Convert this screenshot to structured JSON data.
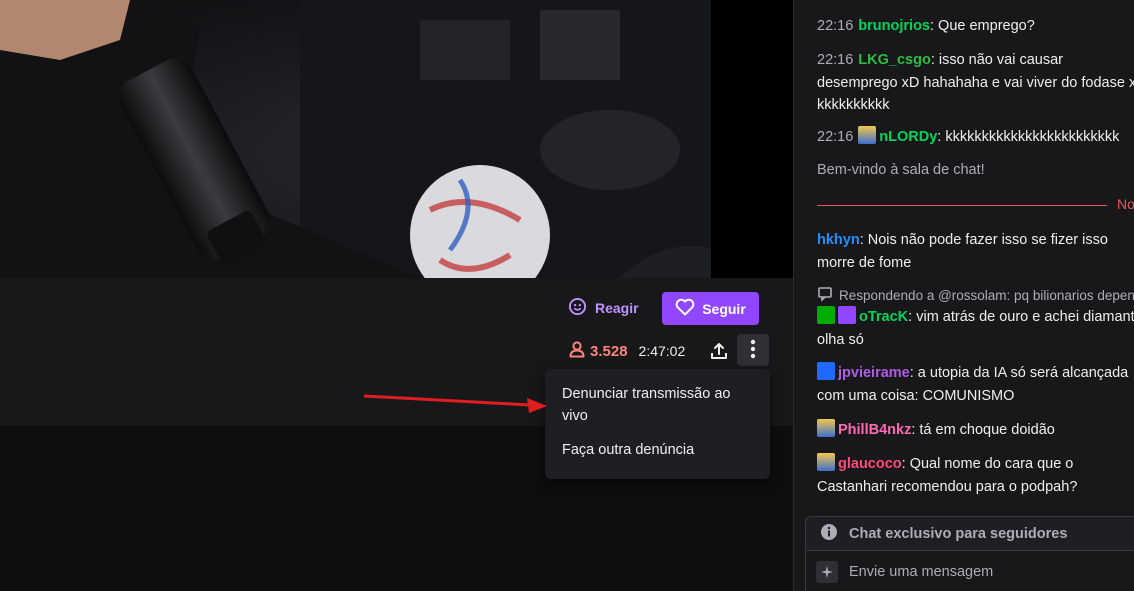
{
  "player": {
    "react_label": "Reagir",
    "follow_label": "Seguir",
    "viewer_count": "3.528",
    "uptime": "2:47:02"
  },
  "more_menu": {
    "items": [
      {
        "label": "Denunciar transmissão ao vivo"
      },
      {
        "label": "Faça outra denúncia"
      }
    ]
  },
  "chat": {
    "messages": [
      {
        "time": "22:16",
        "user": "brunojrios",
        "text": ": Que emprego?",
        "color": "#00d45b"
      },
      {
        "time": "22:16",
        "user": "LKG_csgo",
        "text": ": isso não vai causar desemprego xD hahahaha e vai viver do fodase xD kkkkkkkkkk",
        "color": "#2ebd40"
      },
      {
        "time": "22:16",
        "user": "nLORDy",
        "text": ": kkkkkkkkkkkkkkkkkkkkkkkk",
        "color": "#00d45b"
      }
    ],
    "welcome": "Bem-vindo à sala de chat!",
    "new_label": "Novas",
    "new_messages": [
      {
        "user": "hkhyn",
        "text": ": Nois não pode fazer isso se fizer isso morre de fome",
        "color": "#1e90ff"
      },
      {
        "reply": "Respondendo a @rossolam: pq bilionarios depende",
        "user": "oTracK",
        "text": ": vim atrás de ouro e achei diamante, olha só",
        "color": "#00d45b"
      },
      {
        "user": "jpvieirame",
        "text": ": a utopia da IA só será alcançada com uma coisa: COMUNISMO",
        "color": "#b05ce6"
      },
      {
        "user": "PhillB4nkz",
        "text": ": tá em choque doidão",
        "color": "#ff69b4"
      },
      {
        "user": "glaucoco",
        "text": ": Qual nome do cara que o Castanhari recomendou para o podpah?",
        "color": "#ff4a7a"
      }
    ],
    "followers_only": "Chat exclusivo para seguidores",
    "input_placeholder": "Envie uma mensagem"
  },
  "colors": {
    "accent": "#9147ff",
    "accent_text": "#bf94ff",
    "live": "#ff8280",
    "arrow": "#e01e1e"
  }
}
